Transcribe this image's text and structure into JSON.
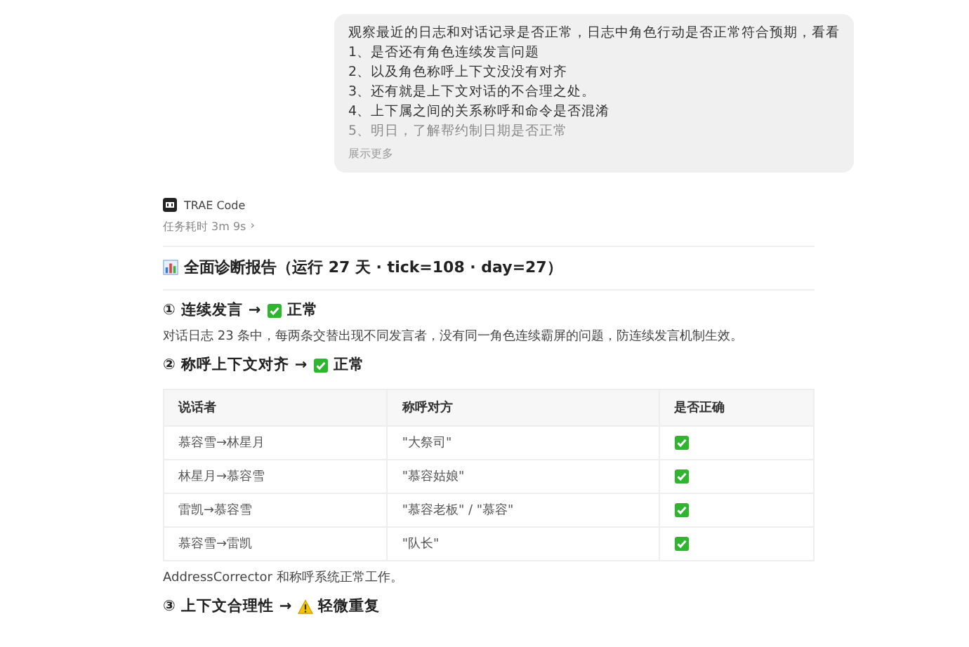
{
  "user_message": {
    "intro": "观察最近的日志和对话记录是否正常，日志中角色行动是否正常符合预期，看看",
    "items": [
      {
        "text": "1、是否还有角色连续发言问题",
        "faded": false
      },
      {
        "text": "2、以及角色称呼上下文没没有对齐",
        "faded": false
      },
      {
        "text": "3、还有就是上下文对话的不合理之处。",
        "faded": false
      },
      {
        "text": "4、上下属之间的关系称呼和命令是否混淆",
        "faded": false
      },
      {
        "text": "5、明日，了解帮约制日期是否正常",
        "faded": true
      }
    ],
    "expand_link": "展示更多"
  },
  "assistant": {
    "name": "TRAE Code",
    "duration": "任务耗时 3m 9s",
    "duration_caret": "›"
  },
  "report": {
    "title": "全面诊断报告（运行 27 天 · tick=108 · day=27）",
    "sections": [
      {
        "number": "①",
        "title": "连续发言",
        "arrow": "→",
        "kind": "ok",
        "status": "正常",
        "paragraph": "对话日志 23 条中，每两条交替出现不同发言者，没有同一角色连续霸屏的问题，防连续发言机制生效。"
      },
      {
        "number": "②",
        "title": "称呼上下文对齐",
        "arrow": "→",
        "kind": "ok",
        "status": "正常",
        "table": {
          "columns": [
            "说话者",
            "称呼对方",
            "是否正确"
          ],
          "rows": [
            {
              "speaker": "慕容雪→林星月",
              "address": "\"大祭司\"",
              "correct": true
            },
            {
              "speaker": "林星月→慕容雪",
              "address": "\"慕容姑娘\"",
              "correct": true
            },
            {
              "speaker": "雷凯→慕容雪",
              "address": "\"慕容老板\" / \"慕容\"",
              "correct": true
            },
            {
              "speaker": "慕容雪→雷凯",
              "address": "\"队长\"",
              "correct": true
            }
          ]
        },
        "paragraph": "AddressCorrector 和称呼系统正常工作。"
      },
      {
        "number": "③",
        "title": "上下文合理性",
        "arrow": "→",
        "kind": "warn",
        "status": "轻微重复"
      }
    ]
  }
}
